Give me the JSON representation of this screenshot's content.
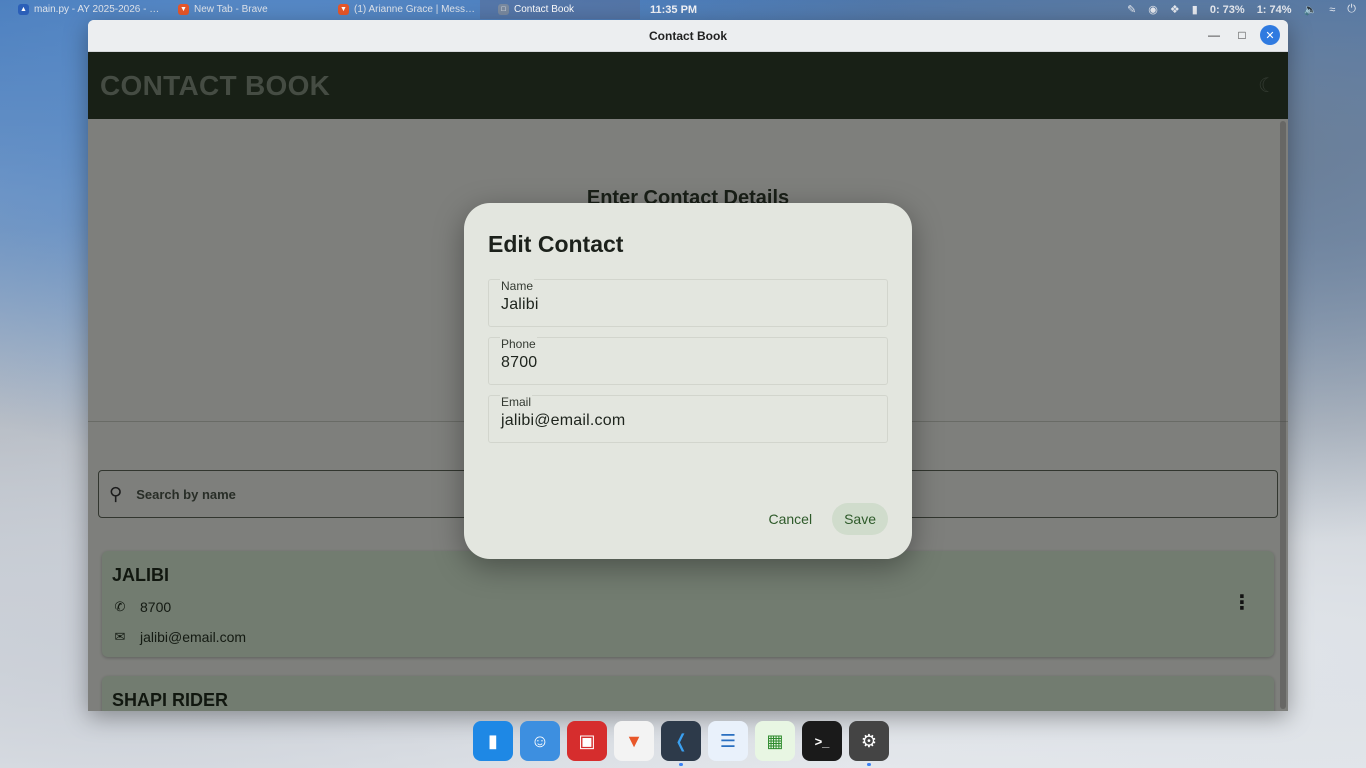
{
  "taskbar": {
    "tabs": [
      {
        "label": "main.py - AY 2025-2026 - V...",
        "icon": "vscode-icon",
        "color": "#2b5fb8"
      },
      {
        "label": "New Tab - Brave",
        "icon": "brave-icon",
        "color": "#e8572a"
      },
      {
        "label": "(1) Arianne Grace | Messen...",
        "icon": "brave-icon",
        "color": "#e8572a"
      },
      {
        "label": "Contact Book",
        "icon": "app-icon",
        "color": "#7a8aa0"
      }
    ],
    "clock": "11:35 PM",
    "battery1": "0: 73%",
    "battery2": "1: 74%"
  },
  "window": {
    "title": "Contact Book"
  },
  "app": {
    "title": "CONTACT BOOK",
    "form_heading": "Enter Contact Details",
    "search_placeholder": "Search by name",
    "contacts": [
      {
        "name": "JALIBI",
        "phone": "8700",
        "email": "jalibi@email.com"
      },
      {
        "name": "SHAPI RIDER"
      }
    ]
  },
  "dialog": {
    "title": "Edit Contact",
    "fields": [
      {
        "label": "Name",
        "value": "Jalibi"
      },
      {
        "label": "Phone",
        "value": "8700"
      },
      {
        "label": "Email",
        "value": "jalibi@email.com"
      }
    ],
    "cancel_label": "Cancel",
    "save_label": "Save"
  },
  "colors": {
    "header_bg": "#2c3b28",
    "accent_green": "#2e5a2a",
    "card_bg": "#cfe2cd",
    "close_button": "#2f7ae0"
  },
  "dock": [
    {
      "name": "launcher-icon",
      "color": "#1e88e5"
    },
    {
      "name": "finder-icon",
      "color": "#3d8fe0"
    },
    {
      "name": "screenshot-icon",
      "color": "#d62d2d"
    },
    {
      "name": "brave-icon",
      "color": "#f3f3f3"
    },
    {
      "name": "vscode-icon",
      "color": "#2d3a4a"
    },
    {
      "name": "writer-icon",
      "color": "#e9f1fb"
    },
    {
      "name": "calc-icon",
      "color": "#e8f6e3"
    },
    {
      "name": "terminal-icon",
      "color": "#1a1a1a"
    },
    {
      "name": "settings-icon",
      "color": "#444444"
    }
  ]
}
